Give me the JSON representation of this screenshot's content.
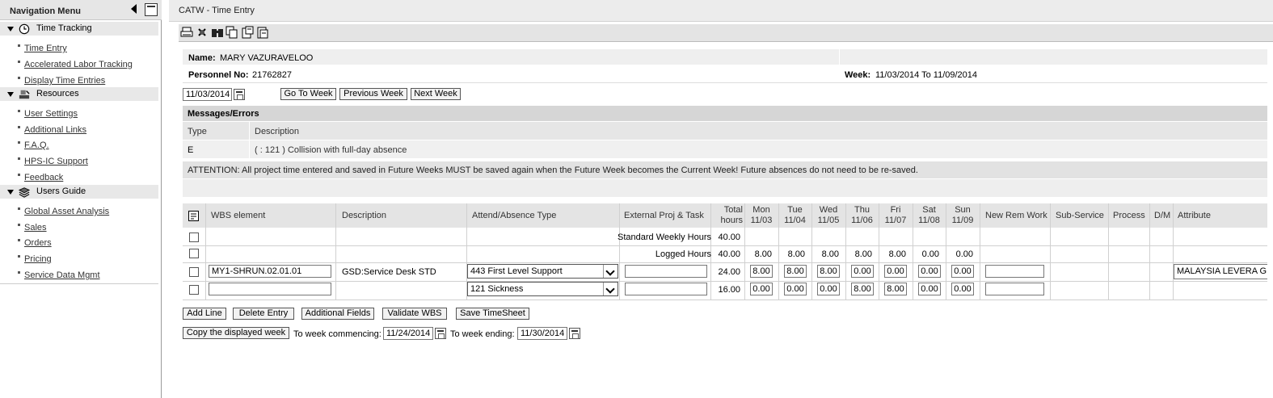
{
  "nav": {
    "title": "Navigation Menu",
    "sections": [
      {
        "label": "Time Tracking",
        "icon": "clock-icon",
        "items": [
          "Time Entry",
          "Accelerated Labor Tracking",
          "Display Time Entries"
        ]
      },
      {
        "label": "Resources",
        "icon": "resources-icon",
        "items": [
          "User Settings",
          "Additional Links",
          "F.A.Q.",
          "HPS-IC Support",
          "Feedback"
        ]
      },
      {
        "label": "Users Guide",
        "icon": "book-icon",
        "items": [
          "Global Asset Analysis",
          "Sales",
          "Orders",
          "Pricing",
          "Service Data Mgmt"
        ]
      }
    ]
  },
  "page": {
    "title": "CATW - Time Entry"
  },
  "toolbar": {
    "icons": [
      "print-icon",
      "settings-icon",
      "find-icon",
      "copy-icon",
      "paste-icon",
      "export-icon"
    ]
  },
  "header": {
    "name_label": "Name:",
    "name_value": "MARY VAZURAVELOO",
    "personnel_label": "Personnel No:",
    "personnel_value": "21762827",
    "week_label": "Week:",
    "week_value": "11/03/2014 To 11/09/2014"
  },
  "weeknav": {
    "date_value": "11/03/2014",
    "goto_label": "Go To Week",
    "prev_label": "Previous Week",
    "next_label": "Next Week"
  },
  "messages": {
    "title": "Messages/Errors",
    "col_type": "Type",
    "col_desc": "Description",
    "rows": [
      {
        "type": "E",
        "desc": "( : 121 ) Collision with full-day absence"
      }
    ],
    "attention": "ATTENTION: All project time entered and saved in Future Weeks MUST be saved again when the Future Week becomes the Current Week! Future absences do not need to be re-saved."
  },
  "grid": {
    "headers": {
      "wbs": "WBS element",
      "desc": "Description",
      "attend": "Attend/Absence Type",
      "ext": "External Proj & Task",
      "total1": "Total",
      "total2": "hours",
      "days": [
        {
          "d": "Mon",
          "date": "11/03"
        },
        {
          "d": "Tue",
          "date": "11/04"
        },
        {
          "d": "Wed",
          "date": "11/05"
        },
        {
          "d": "Thu",
          "date": "11/06"
        },
        {
          "d": "Fri",
          "date": "11/07"
        },
        {
          "d": "Sat",
          "date": "11/08"
        },
        {
          "d": "Sun",
          "date": "11/09"
        }
      ],
      "newrem": "New Rem Work",
      "subservice": "Sub-Service",
      "process": "Process",
      "dm": "D/M",
      "attribute": "Attribute"
    },
    "standard": {
      "label": "Standard Weekly Hours",
      "total": "40.00"
    },
    "logged": {
      "label": "Logged Hours",
      "total": "40.00",
      "days": [
        "8.00",
        "8.00",
        "8.00",
        "8.00",
        "8.00",
        "0.00",
        "0.00"
      ]
    },
    "rows": [
      {
        "wbs": "MY1-SHRUN.02.01.01",
        "desc": "GSD:Service Desk STD",
        "attend": "443 First Level Support",
        "ext": "",
        "total": "24.00",
        "days": [
          "8.00",
          "8.00",
          "8.00",
          "0.00",
          "0.00",
          "0.00",
          "0.00"
        ],
        "newrem": "",
        "attribute": "MALAYSIA LEVERA GE"
      },
      {
        "wbs": "",
        "desc": "",
        "attend": "121 Sickness",
        "ext": "",
        "total": "16.00",
        "days": [
          "0.00",
          "0.00",
          "0.00",
          "8.00",
          "8.00",
          "0.00",
          "0.00"
        ],
        "newrem": "",
        "attribute": ""
      }
    ]
  },
  "actions": {
    "add_line": "Add Line",
    "delete_entry": "Delete Entry",
    "additional_fields": "Additional Fields",
    "validate_wbs": "Validate WBS",
    "save_timesheet": "Save TimeSheet"
  },
  "copy": {
    "button": "Copy the displayed week",
    "commencing_label": "To week commencing:",
    "commencing_value": "11/24/2014",
    "ending_label": "To week ending:",
    "ending_value": "11/30/2014"
  }
}
